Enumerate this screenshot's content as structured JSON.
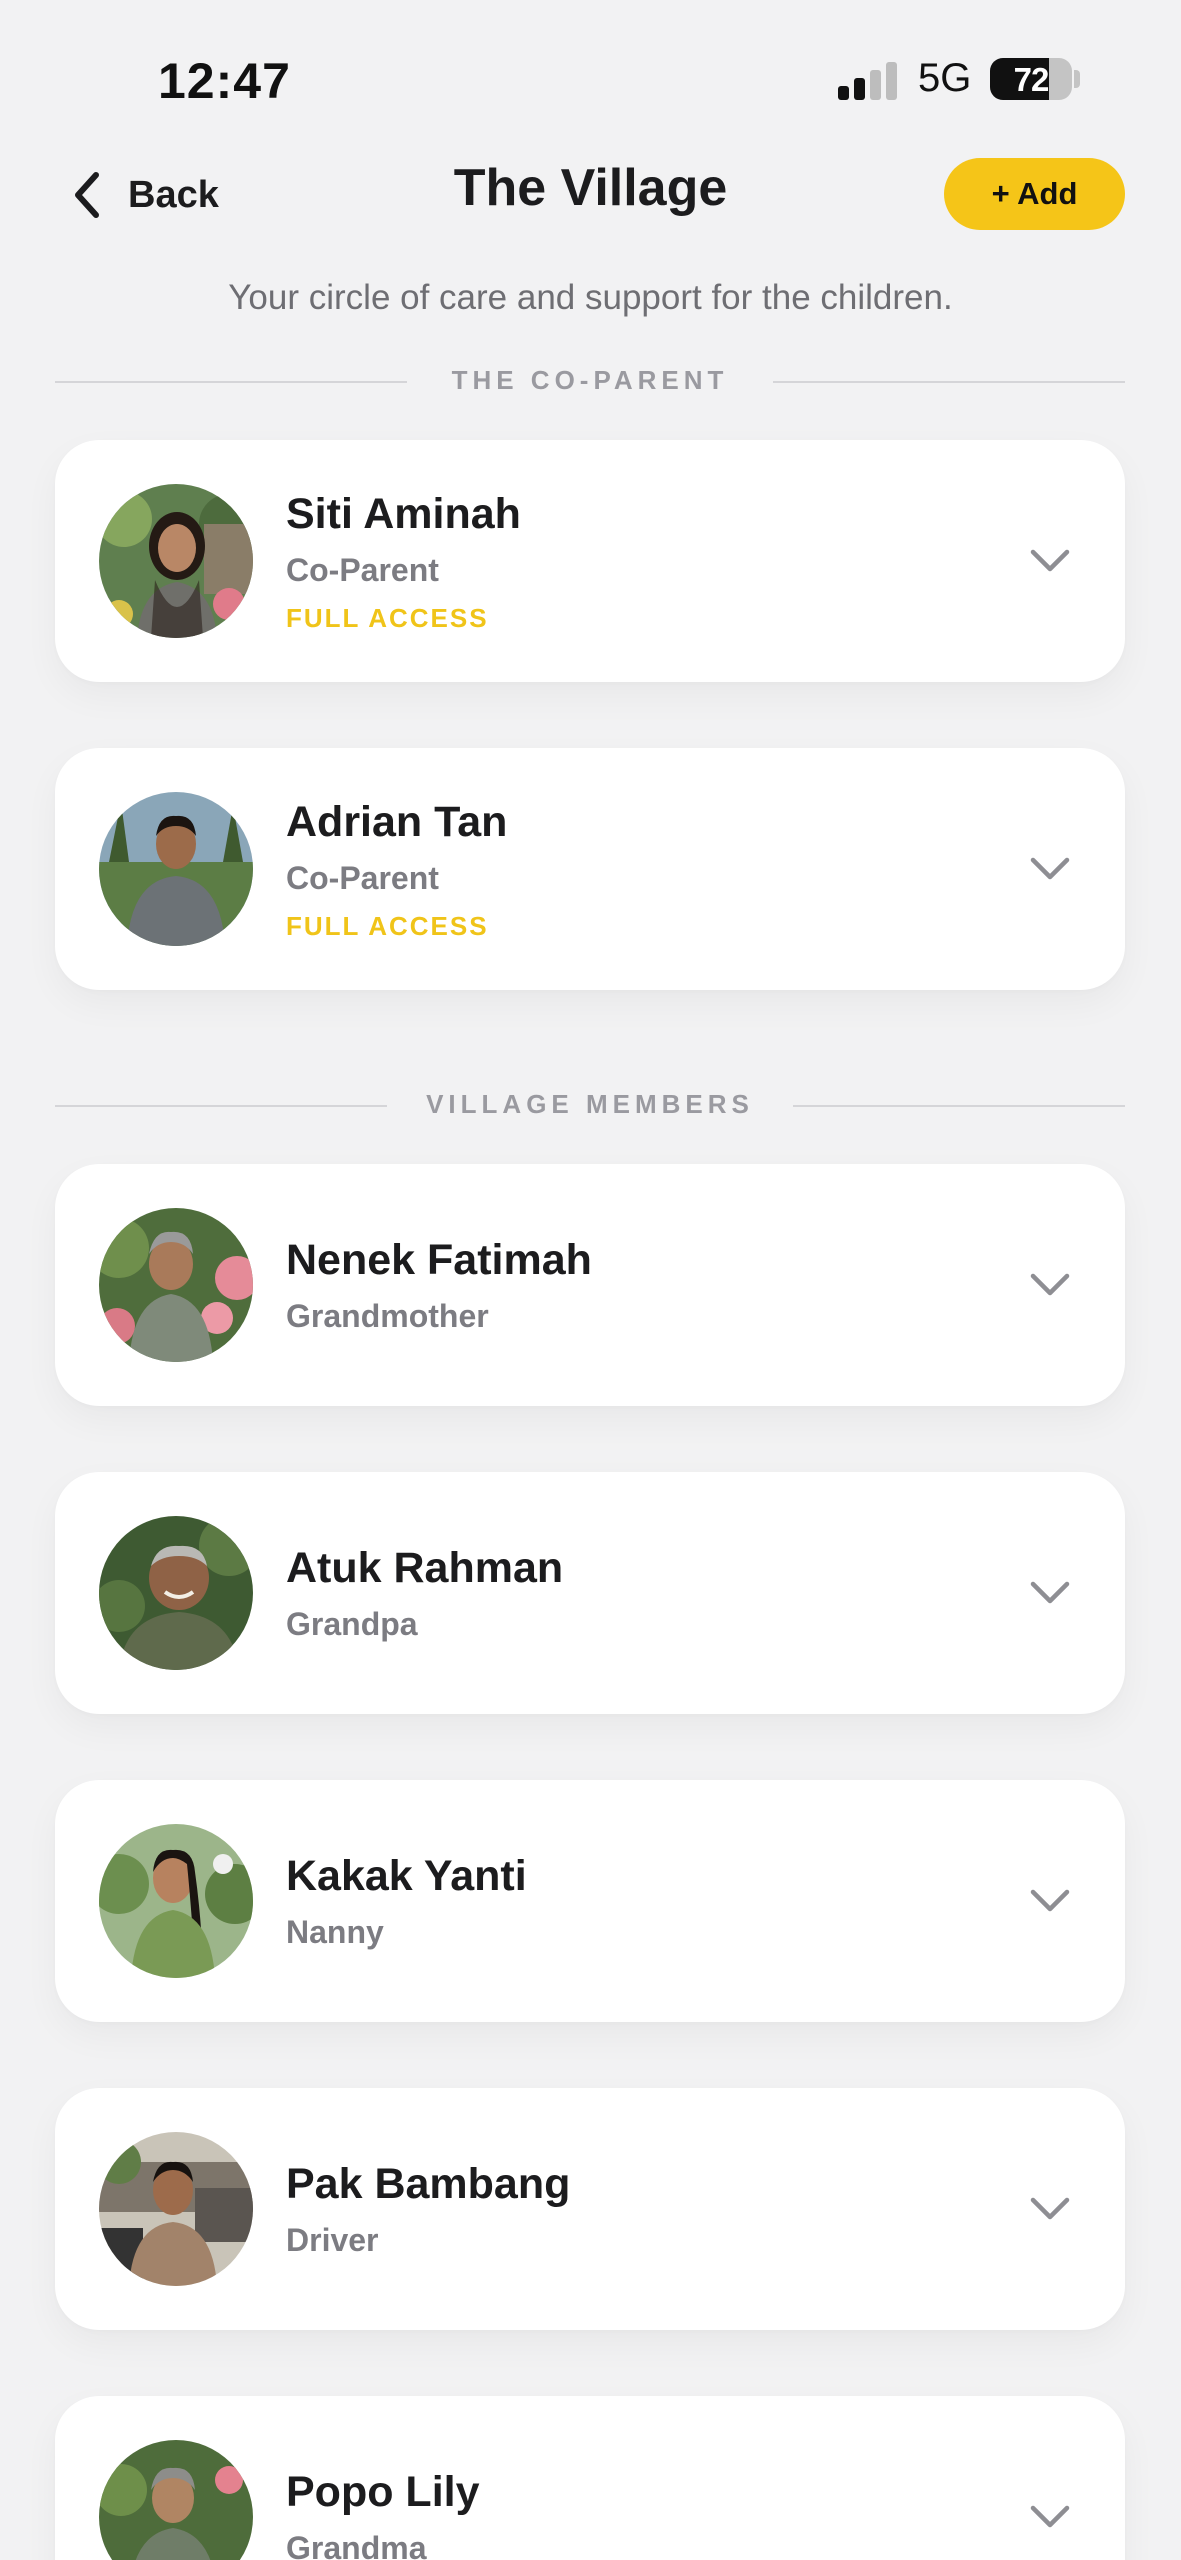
{
  "status_bar": {
    "time": "12:47",
    "network": "5G",
    "battery_level": "72",
    "battery_fraction": 0.72
  },
  "nav": {
    "back_label": "Back",
    "title": "The Village",
    "add_label": "+ Add"
  },
  "subtitle": "Your circle of care and support for the children.",
  "sections": [
    {
      "title": "THE CO-PARENT",
      "members": [
        {
          "name": "Siti Aminah",
          "role": "Co-Parent",
          "access": "FULL ACCESS",
          "avatar": "woman-garden-photo"
        },
        {
          "name": "Adrian Tan",
          "role": "Co-Parent",
          "access": "FULL ACCESS",
          "avatar": "man-palms-photo"
        }
      ]
    },
    {
      "title": "VILLAGE MEMBERS",
      "members": [
        {
          "name": "Nenek Fatimah",
          "role": "Grandmother",
          "avatar": "grandmother-flowers-photo"
        },
        {
          "name": "Atuk Rahman",
          "role": "Grandpa",
          "avatar": "grandpa-garden-photo"
        },
        {
          "name": "Kakak Yanti",
          "role": "Nanny",
          "avatar": "nanny-garden-photo"
        },
        {
          "name": "Pak Bambang",
          "role": "Driver",
          "avatar": "driver-house-photo"
        },
        {
          "name": "Popo Lily",
          "role": "Grandma",
          "avatar": "grandma-flowers-photo"
        }
      ]
    }
  ],
  "colors": {
    "background": "#f2f2f3",
    "accent_yellow": "#f5c518",
    "access_text": "#f0c419",
    "secondary_text": "#7c7c82"
  },
  "icons": [
    "back-chevron-icon",
    "chevron-down-icon"
  ]
}
